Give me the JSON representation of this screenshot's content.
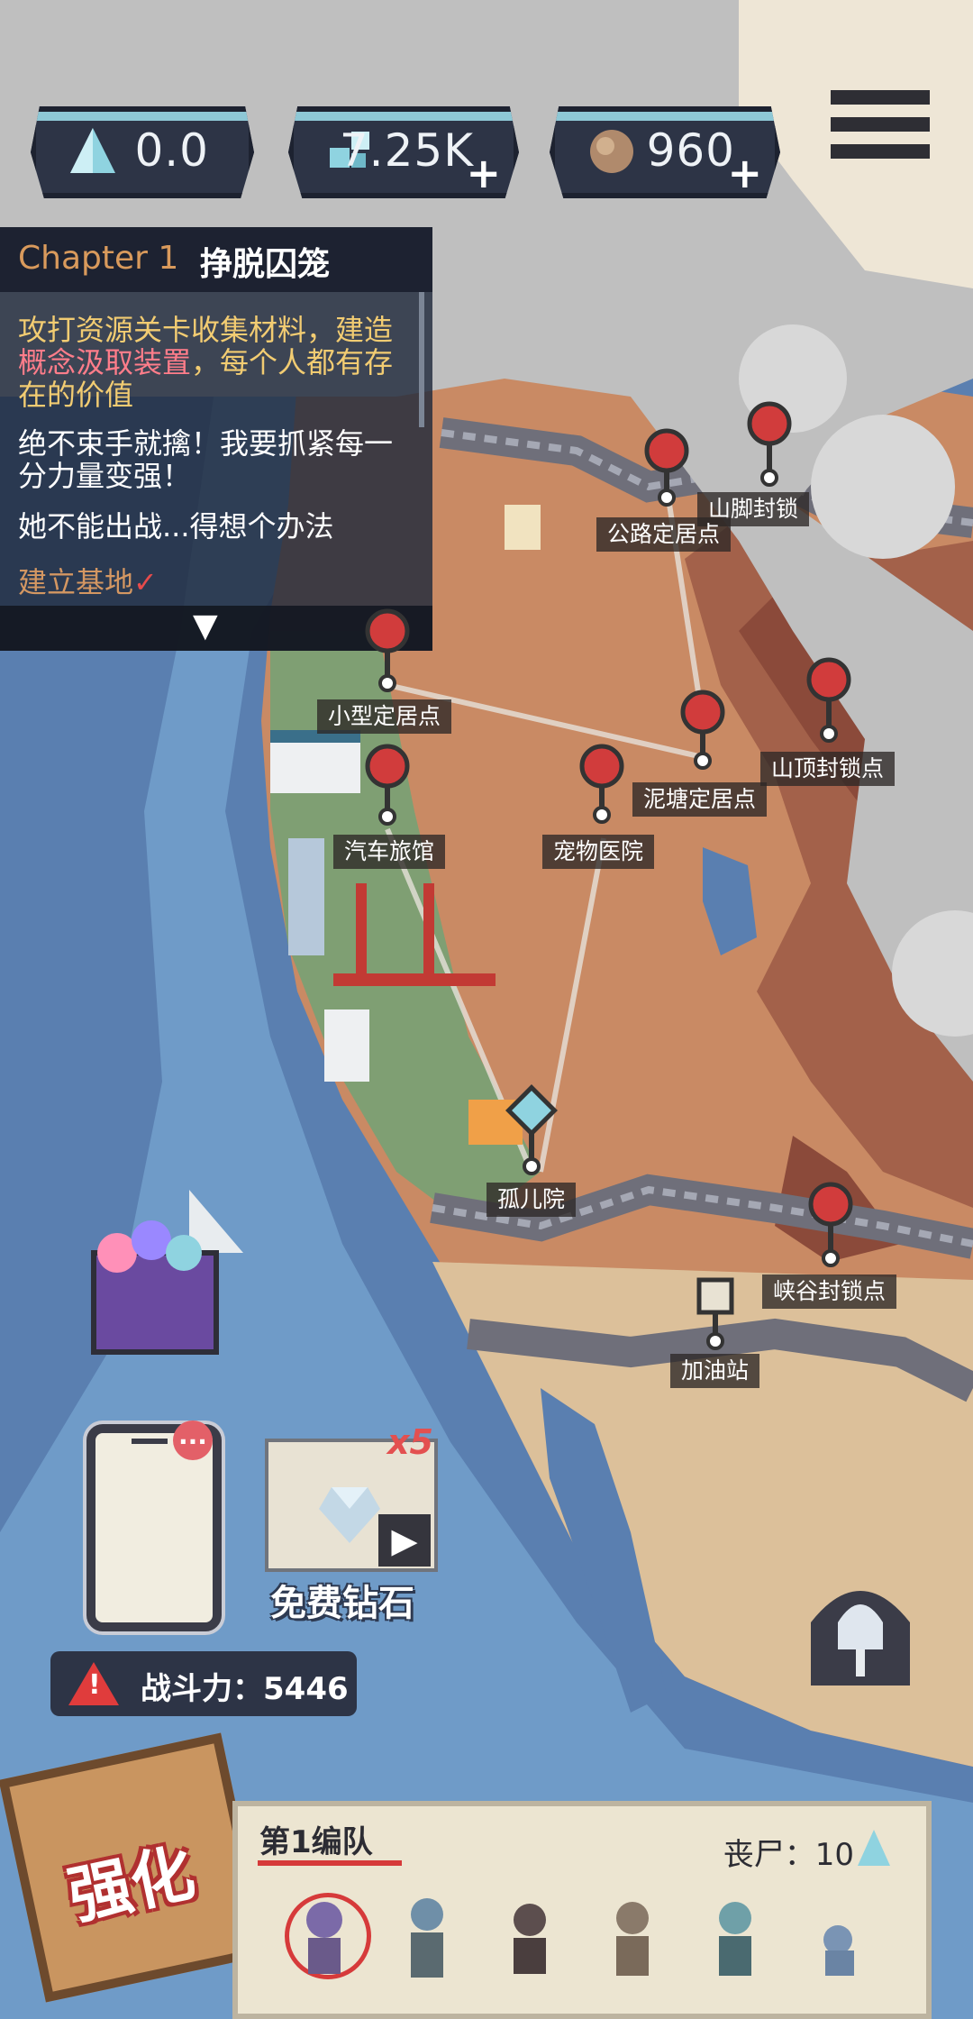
{
  "top_bar": {
    "resource_crystal": {
      "value": "0.0",
      "icon": "triangle-crystal-icon"
    },
    "resource_diamond": {
      "value": "7.25K",
      "icon": "diamond-cluster-icon",
      "plus_label": "+"
    },
    "resource_stone": {
      "value": "960",
      "icon": "stone-icon",
      "plus_label": "+"
    },
    "menu_icon": "hamburger-menu-icon"
  },
  "quest": {
    "chapter": "Chapter 1",
    "title": "挣脱囚笼",
    "line1_pre": "攻打资源关卡收集材料，建造",
    "line1_highlight": "概念汲取装置",
    "line1_post": "，每个人都有存在的价值",
    "line2": "绝不束手就擒！我要抓紧每一分力量变强！",
    "line3": "她不能出战...得想个办法",
    "line4": "建立基地",
    "line4_mark": "✓",
    "collapse_icon": "chevron-down-icon"
  },
  "map_locations": [
    {
      "id": "mountain-foot",
      "label": "山脚封锁"
    },
    {
      "id": "highway",
      "label": "公路定居点"
    },
    {
      "id": "small",
      "label": "小型定居点"
    },
    {
      "id": "summit",
      "label": "山顶封锁点"
    },
    {
      "id": "mud",
      "label": "泥塘定居点"
    },
    {
      "id": "motel",
      "label": "汽车旅馆"
    },
    {
      "id": "pet",
      "label": "宠物医院"
    },
    {
      "id": "orphanage",
      "label": "孤儿院"
    },
    {
      "id": "canyon",
      "label": "峡谷封锁点"
    },
    {
      "id": "gas",
      "label": "加油站"
    }
  ],
  "phone": {
    "badge": "..."
  },
  "free_diamond": {
    "label": "免费钻石",
    "multiplier": "x5"
  },
  "combat_power": {
    "label": "战斗力：5446"
  },
  "enhance": {
    "label": "强化"
  },
  "squad": {
    "title": "第1编队",
    "zombie_count": "丧尸：10",
    "members": [
      "member-1",
      "member-2",
      "member-3",
      "member-4",
      "member-5",
      "member-6"
    ]
  },
  "colors": {
    "ocean": "#5a7fb0",
    "land": "#c98a64",
    "mountain": "#8b4a3a",
    "fog": "#bfbfbf",
    "accent_red": "#d63a3a",
    "panel": "#2d3446"
  }
}
